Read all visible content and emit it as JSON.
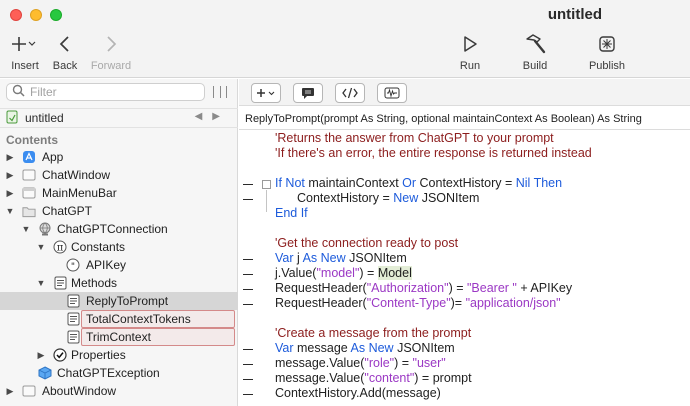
{
  "window": {
    "title": "untitled"
  },
  "toolbar": {
    "insert_label": "Insert",
    "back_label": "Back",
    "forward_label": "Forward",
    "run_label": "Run",
    "build_label": "Build",
    "publish_label": "Publish"
  },
  "sidebar": {
    "search_placeholder": "Filter",
    "project_name": "untitled",
    "contents_header": "Contents",
    "tree": [
      {
        "label": "App"
      },
      {
        "label": "ChatWindow"
      },
      {
        "label": "MainMenuBar"
      },
      {
        "label": "ChatGPT"
      },
      {
        "label": "ChatGPTConnection"
      },
      {
        "label": "Constants"
      },
      {
        "label": "APIKey"
      },
      {
        "label": "Methods"
      },
      {
        "label": "ReplyToPrompt"
      },
      {
        "label": "TotalContextTokens"
      },
      {
        "label": "TrimContext"
      },
      {
        "label": "Properties"
      },
      {
        "label": "ChatGPTException"
      },
      {
        "label": "AboutWindow"
      }
    ]
  },
  "editor": {
    "signature": "ReplyToPrompt(prompt As String, optional maintainContext As Boolean) As String",
    "code": {
      "l1": "'Returns the answer from ChatGPT to your prompt",
      "l2": "'If there's an error, the entire response is returned instead",
      "l3": {
        "a": "If Not",
        "b": " maintainContext ",
        "c": "Or",
        "d": " ContextHistory = ",
        "e": "Nil Then"
      },
      "l4": {
        "a": "ContextHistory = ",
        "b": "New",
        "c": " JSONItem"
      },
      "l5": "End If",
      "l6": "'Get the connection ready to post",
      "l7": {
        "a": "Var",
        "b": " j ",
        "c": "As New",
        "d": " JSONItem"
      },
      "l8": {
        "a": "j.Value(",
        "b": "\"model\"",
        "c": ") = ",
        "d": "Model"
      },
      "l9": {
        "a": "RequestHeader(",
        "b": "\"Authorization\"",
        "c": ") = ",
        "d": "\"Bearer \"",
        "e": " + APIKey"
      },
      "l10": {
        "a": "RequestHeader(",
        "b": "\"Content-Type\"",
        "c": ")= ",
        "d": "\"application/json\""
      },
      "l11": "'Create a message from the prompt",
      "l12": {
        "a": "Var",
        "b": " message ",
        "c": "As New",
        "d": " JSONItem"
      },
      "l13": {
        "a": "message.Value(",
        "b": "\"role\"",
        "c": ") = ",
        "d": "\"user\""
      },
      "l14": {
        "a": "message.Value(",
        "b": "\"content\"",
        "c": ") = prompt"
      },
      "l15": "ContextHistory.Add(message)"
    }
  },
  "colors": {
    "comment": "#8c1d1d",
    "keyword": "#1d5bdb",
    "string": "#9b38c4",
    "selection": "#d6d6d6"
  }
}
